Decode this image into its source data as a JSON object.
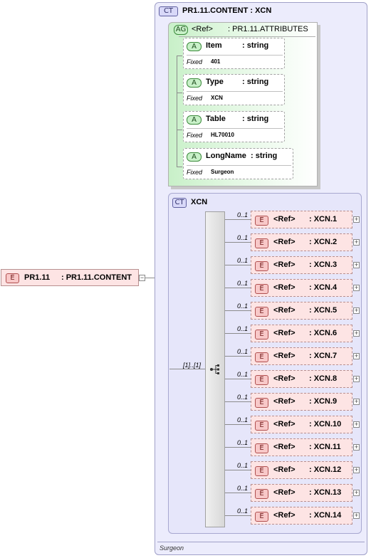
{
  "root_element": {
    "badge": "E",
    "name": "PR1.11",
    "type": ": PR1.11.CONTENT"
  },
  "complex_type": {
    "badge": "CT",
    "name": "PR1.11.CONTENT : XCN",
    "annotation": "Surgeon"
  },
  "attribute_group": {
    "badge": "AG",
    "ref": "<Ref>",
    "type": ": PR1.11.ATTRIBUTES"
  },
  "attributes": [
    {
      "badge": "A",
      "name": "Item",
      "type": ": string",
      "fixed_label": "Fixed",
      "fixed_value": "401"
    },
    {
      "badge": "A",
      "name": "Type",
      "type": ": string",
      "fixed_label": "Fixed",
      "fixed_value": "XCN"
    },
    {
      "badge": "A",
      "name": "Table",
      "type": ": string",
      "fixed_label": "Fixed",
      "fixed_value": "HL70010"
    },
    {
      "badge": "A",
      "name": "LongName",
      "type": ": string",
      "fixed_label": "Fixed",
      "fixed_value": "Surgeon"
    }
  ],
  "inner_type": {
    "badge": "CT",
    "name": "XCN"
  },
  "sequence_multiplicity": "[1]..[1]",
  "children": [
    {
      "badge": "E",
      "ref": "<Ref>",
      "type": ": XCN.1",
      "card": "0..1"
    },
    {
      "badge": "E",
      "ref": "<Ref>",
      "type": ": XCN.2",
      "card": "0..1"
    },
    {
      "badge": "E",
      "ref": "<Ref>",
      "type": ": XCN.3",
      "card": "0..1"
    },
    {
      "badge": "E",
      "ref": "<Ref>",
      "type": ": XCN.4",
      "card": "0..1"
    },
    {
      "badge": "E",
      "ref": "<Ref>",
      "type": ": XCN.5",
      "card": "0..1"
    },
    {
      "badge": "E",
      "ref": "<Ref>",
      "type": ": XCN.6",
      "card": "0..1"
    },
    {
      "badge": "E",
      "ref": "<Ref>",
      "type": ": XCN.7",
      "card": "0..1"
    },
    {
      "badge": "E",
      "ref": "<Ref>",
      "type": ": XCN.8",
      "card": "0..1"
    },
    {
      "badge": "E",
      "ref": "<Ref>",
      "type": ": XCN.9",
      "card": "0..1"
    },
    {
      "badge": "E",
      "ref": "<Ref>",
      "type": ": XCN.10",
      "card": "0..1"
    },
    {
      "badge": "E",
      "ref": "<Ref>",
      "type": ": XCN.11",
      "card": "0..1"
    },
    {
      "badge": "E",
      "ref": "<Ref>",
      "type": ": XCN.12",
      "card": "0..1"
    },
    {
      "badge": "E",
      "ref": "<Ref>",
      "type": ": XCN.13",
      "card": "0..1"
    },
    {
      "badge": "E",
      "ref": "<Ref>",
      "type": ": XCN.14",
      "card": "0..1"
    }
  ]
}
